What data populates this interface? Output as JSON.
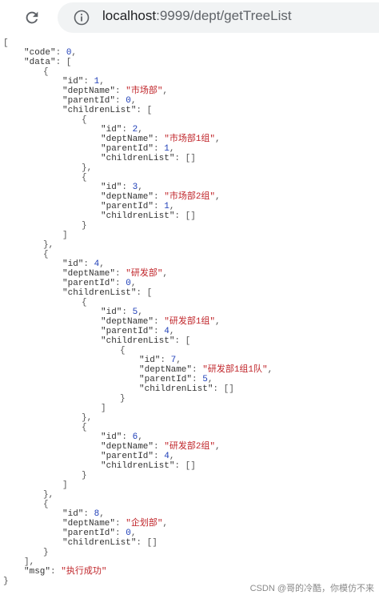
{
  "browser": {
    "url_host": "localhost",
    "url_rest": ":9999/dept/getTreeList"
  },
  "json": {
    "code_key": "\"code\"",
    "code_val": "0",
    "data_key": "\"data\"",
    "msg_key": "\"msg\"",
    "msg_val": "\"执行成功\"",
    "keys": {
      "id": "\"id\"",
      "deptName": "\"deptName\"",
      "parentId": "\"parentId\"",
      "childrenList": "\"childrenList\""
    },
    "depts": [
      {
        "id": "1",
        "deptName": "\"市场部\"",
        "parentId": "0"
      },
      {
        "id": "2",
        "deptName": "\"市场部1组\"",
        "parentId": "1"
      },
      {
        "id": "3",
        "deptName": "\"市场部2组\"",
        "parentId": "1"
      },
      {
        "id": "4",
        "deptName": "\"研发部\"",
        "parentId": "0"
      },
      {
        "id": "5",
        "deptName": "\"研发部1组\"",
        "parentId": "4"
      },
      {
        "id": "7",
        "deptName": "\"研发部1组1队\"",
        "parentId": "5"
      },
      {
        "id": "6",
        "deptName": "\"研发部2组\"",
        "parentId": "4"
      },
      {
        "id": "8",
        "deptName": "\"企划部\"",
        "parentId": "0"
      }
    ]
  },
  "watermark": "CSDN @哥的冷酷，你模仿不来"
}
